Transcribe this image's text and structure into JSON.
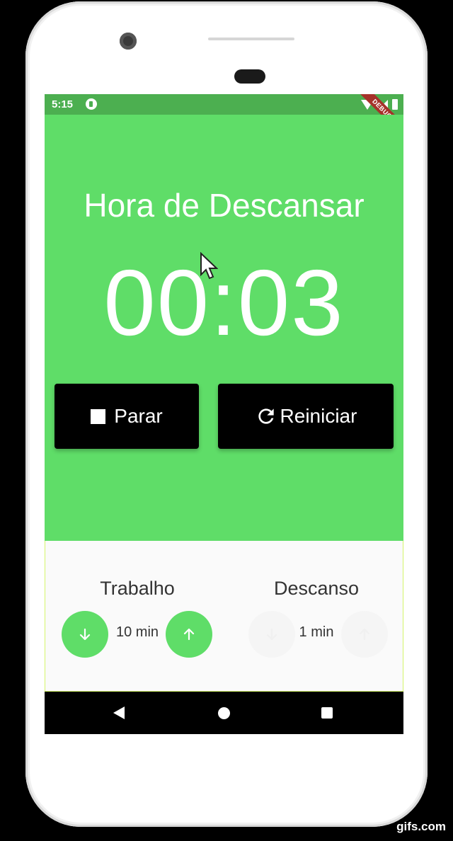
{
  "status_bar": {
    "time": "5:15",
    "debug_label": "DEBUG",
    "icons": [
      "app-notification-icon",
      "wifi-icon",
      "signal-icon",
      "battery-icon"
    ]
  },
  "timer": {
    "title": "Hora de Descansar",
    "display": "00:03",
    "background_color": "#5fdd68"
  },
  "actions": {
    "stop_label": "Parar",
    "stop_icon": "stop-icon",
    "restart_label": "Reiniciar",
    "restart_icon": "refresh-icon"
  },
  "settings": {
    "work": {
      "label": "Trabalho",
      "value": "10 min",
      "decrease_icon": "arrow-down-icon",
      "increase_icon": "arrow-up-icon"
    },
    "rest": {
      "label": "Descanso",
      "value": "1 min",
      "decrease_icon": "arrow-down-icon",
      "increase_icon": "arrow-up-icon"
    }
  },
  "nav_bar": {
    "icons": [
      "back-icon",
      "home-icon",
      "recents-icon"
    ]
  },
  "colors": {
    "accent_green": "#5fdd68",
    "status_green": "#4caf50",
    "button_black": "#000000"
  },
  "watermark": "gifs.com"
}
